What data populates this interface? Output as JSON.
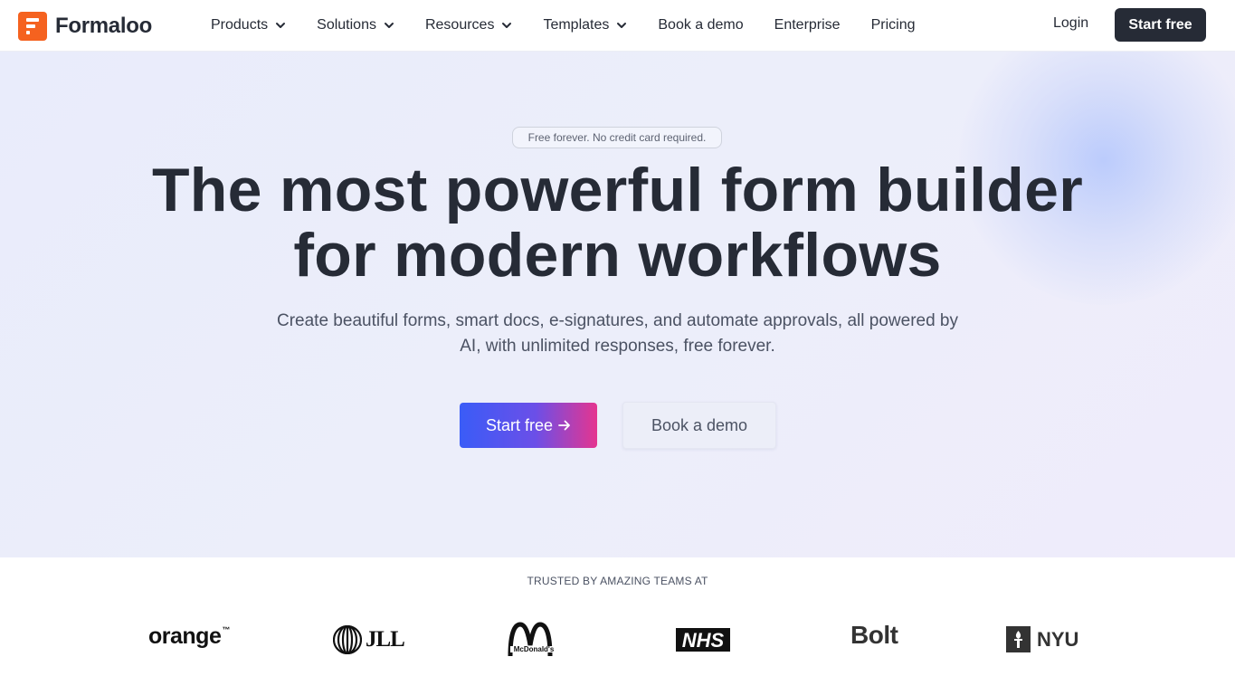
{
  "nav": {
    "brand": "Formaloo",
    "items": [
      {
        "label": "Products",
        "dropdown": true,
        "name": "products"
      },
      {
        "label": "Solutions",
        "dropdown": true,
        "name": "solutions"
      },
      {
        "label": "Resources",
        "dropdown": true,
        "name": "resources"
      },
      {
        "label": "Templates",
        "dropdown": true,
        "name": "templates"
      },
      {
        "label": "Book a demo",
        "dropdown": false,
        "name": "book-a-demo"
      },
      {
        "label": "Enterprise",
        "dropdown": false,
        "name": "enterprise"
      },
      {
        "label": "Pricing",
        "dropdown": false,
        "name": "pricing"
      }
    ],
    "login": "Login",
    "start_free": "Start free"
  },
  "hero": {
    "pill": "Free forever. No credit card required.",
    "title_line1": "The most powerful form builder",
    "title_line2": "for modern workflows",
    "subtitle_line1": "Create beautiful forms, smart docs, e-signatures, and automate approvals, all powered by",
    "subtitle_line2": "AI, with unlimited responses, free forever.",
    "cta_primary": "Start free",
    "cta_primary_icon": "arrow-right-icon",
    "cta_secondary": "Book a demo"
  },
  "trusted": {
    "label": "TRUSTED BY AMAZING TEAMS AT",
    "logos": {
      "orange": "orange",
      "orange_tm": "™",
      "jll": "JLL",
      "mcdonalds": "McDonald's",
      "nhs": "NHS",
      "bolt": "Bolt",
      "nyu": "NYU"
    }
  },
  "colors": {
    "brand_orange": "#f5621f",
    "dark": "#262b36",
    "cta_gradient_start": "#3a5cf7",
    "cta_gradient_end": "#e5358f",
    "hero_bg": "#eceefa"
  }
}
